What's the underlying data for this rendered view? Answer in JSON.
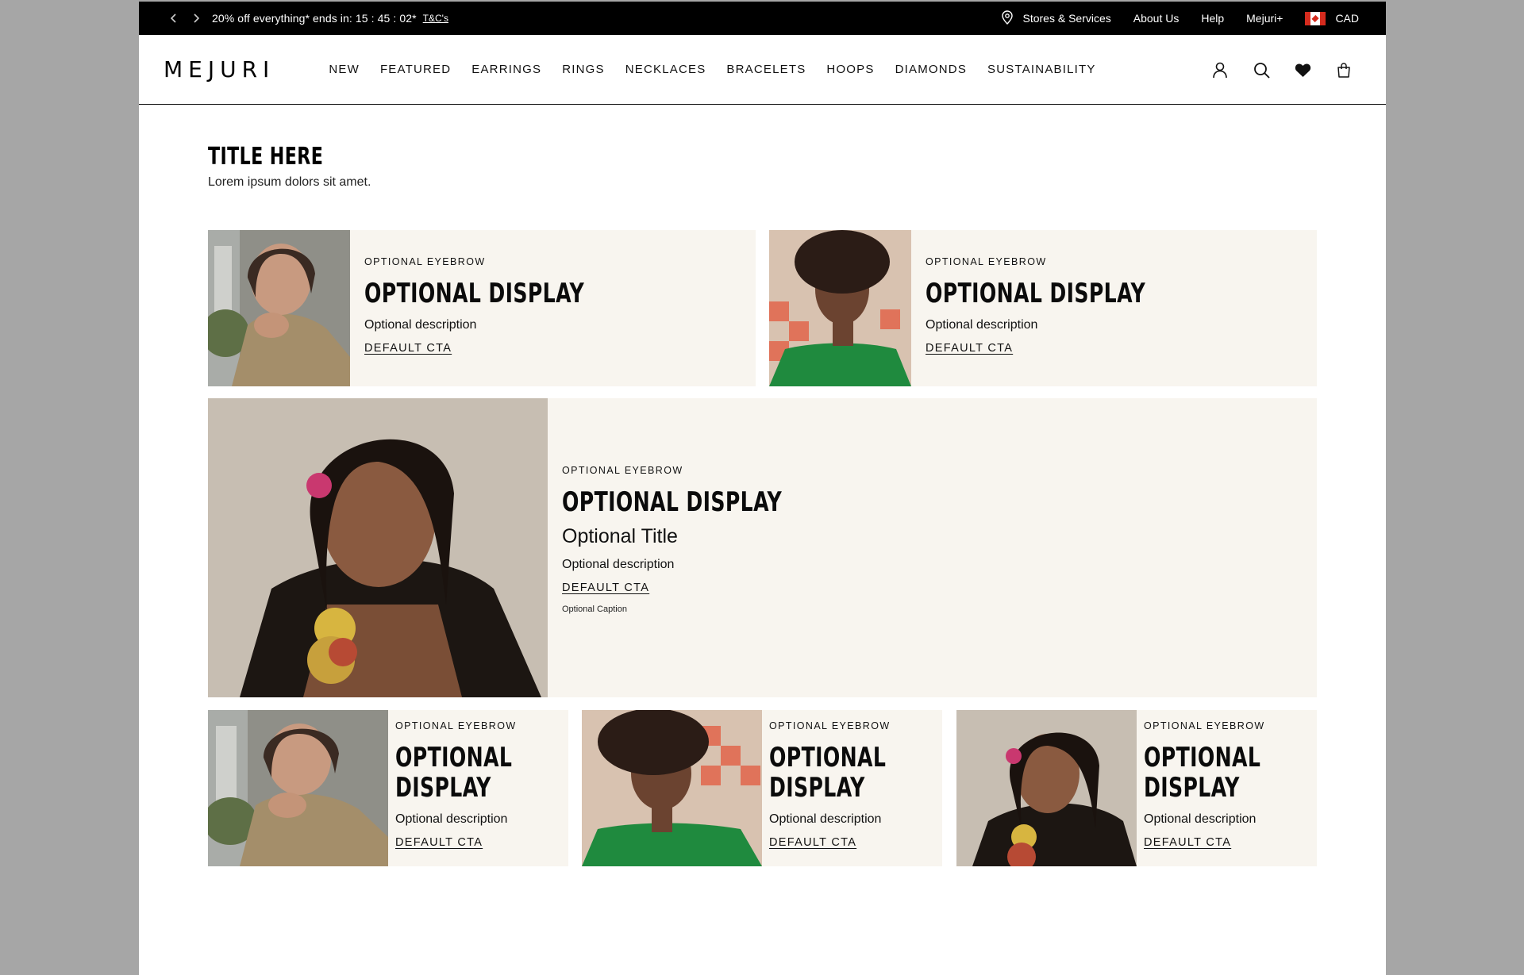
{
  "promo": {
    "message": "20% off everything* ends in: 15 : 45 : 02*",
    "terms_link": "T&C's",
    "links": [
      "Stores & Services",
      "About Us",
      "Help",
      "Mejuri+"
    ],
    "currency": "CAD"
  },
  "header": {
    "logo": "MEJURI",
    "nav": [
      "NEW",
      "FEATURED",
      "EARRINGS",
      "RINGS",
      "NECKLACES",
      "BRACELETS",
      "HOOPS",
      "DIAMONDS",
      "SUSTAINABILITY"
    ]
  },
  "section": {
    "title": "TITLE HERE",
    "subtitle": "Lorem ipsum dolors sit amet."
  },
  "cards_row1": [
    {
      "eyebrow": "OPTIONAL EYEBROW",
      "display": "OPTIONAL DISPLAY",
      "description": "Optional description",
      "cta": "DEFAULT CTA"
    },
    {
      "eyebrow": "OPTIONAL EYEBROW",
      "display": "OPTIONAL DISPLAY",
      "description": "Optional description",
      "cta": "DEFAULT CTA"
    }
  ],
  "feature_card": {
    "eyebrow": "OPTIONAL EYEBROW",
    "display": "OPTIONAL DISPLAY",
    "title": "Optional Title",
    "description": "Optional description",
    "cta": "DEFAULT CTA",
    "caption": "Optional Caption"
  },
  "cards_row3": [
    {
      "eyebrow": "OPTIONAL EYEBROW",
      "display_line1": "OPTIONAL",
      "display_line2": "DISPLAY",
      "description": "Optional description",
      "cta": "DEFAULT CTA"
    },
    {
      "eyebrow": "OPTIONAL EYEBROW",
      "display_line1": "OPTIONAL",
      "display_line2": "DISPLAY",
      "description": "Optional description",
      "cta": "DEFAULT CTA"
    },
    {
      "eyebrow": "OPTIONAL EYEBROW",
      "display_line1": "OPTIONAL",
      "display_line2": "DISPLAY",
      "description": "Optional description",
      "cta": "DEFAULT CTA"
    }
  ],
  "colors": {
    "promo_bg": "#000000",
    "card_bg": "#f8f5ef",
    "outer_bg": "#a6a6a6"
  }
}
